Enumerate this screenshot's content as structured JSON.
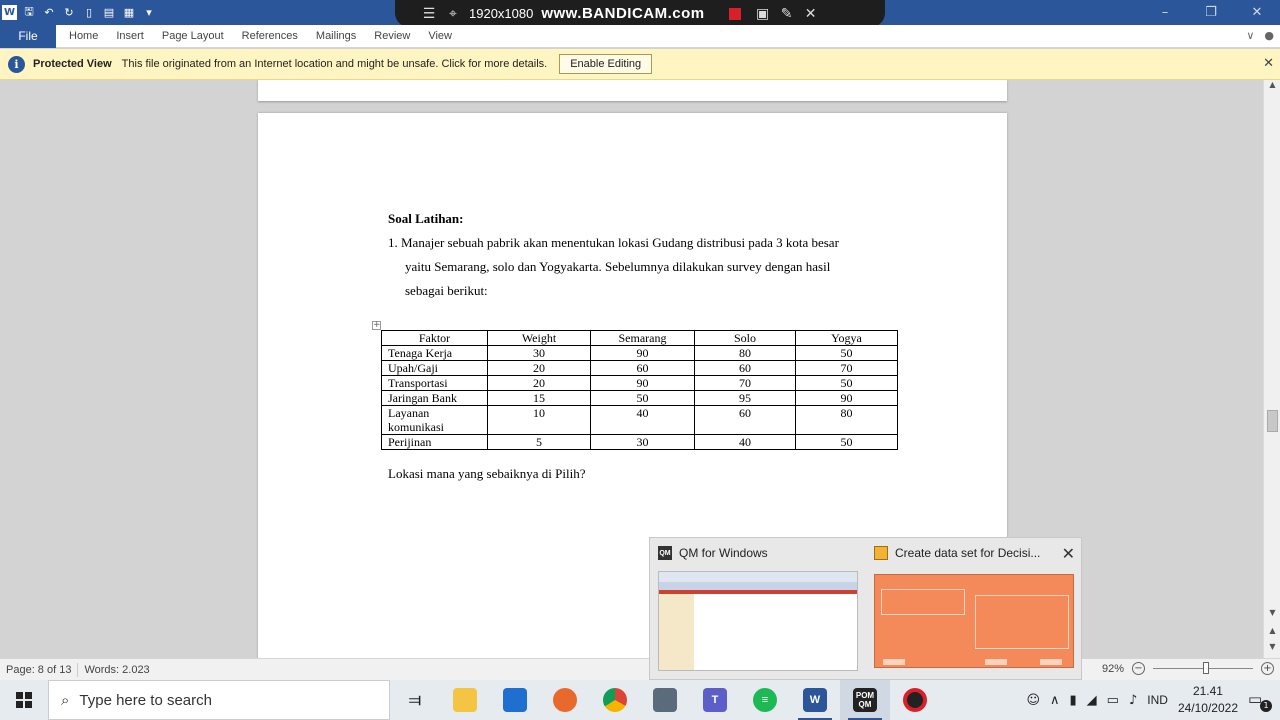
{
  "bandicam": {
    "resolution": "1920x1080",
    "brand": "www.BANDICAM.com"
  },
  "ribbon": {
    "file": "File",
    "tabs": [
      "Home",
      "Insert",
      "Page Layout",
      "References",
      "Mailings",
      "Review",
      "View"
    ]
  },
  "protected_view": {
    "title": "Protected View",
    "message": "This file originated from an Internet location and might be unsafe. Click for more details.",
    "button": "Enable Editing"
  },
  "document": {
    "heading": "Soal Latihan:",
    "paragraph_lines": [
      "1. Manajer sebuah pabrik akan menentukan lokasi Gudang distribusi pada 3 kota besar",
      "yaitu Semarang, solo dan Yogyakarta. Sebelumnya dilakukan survey dengan hasil",
      "sebagai berikut:"
    ],
    "table": {
      "headers": [
        "Faktor",
        "Weight",
        "Semarang",
        "Solo",
        "Yogya"
      ],
      "rows": [
        [
          "Tenaga Kerja",
          "30",
          "90",
          "80",
          "50"
        ],
        [
          "Upah/Gaji",
          "20",
          "60",
          "60",
          "70"
        ],
        [
          "Transportasi",
          "20",
          "90",
          "70",
          "50"
        ],
        [
          "Jaringan Bank",
          "15",
          "50",
          "95",
          "90"
        ],
        [
          "Layanan komunikasi",
          "10",
          "40",
          "60",
          "80"
        ],
        [
          "Perijinan",
          "5",
          "30",
          "40",
          "50"
        ]
      ]
    },
    "question": "Lokasi mana yang sebaiknya di Pilih?"
  },
  "status": {
    "page": "Page: 8 of 13",
    "words": "Words: 2.023",
    "zoom": "92%"
  },
  "popup": {
    "app1": "QM for Windows",
    "app2": "Create data set for Decisi..."
  },
  "taskbar": {
    "search_placeholder": "Type here to search",
    "apps": [
      "task-view",
      "file-explorer",
      "microsoft-store",
      "firefox",
      "chrome",
      "calculator",
      "teams",
      "spotify",
      "word",
      "pom-qm",
      "bandicam"
    ],
    "language": "IND",
    "time": "21.41",
    "date": "24/10/2022",
    "notifications": "1"
  }
}
